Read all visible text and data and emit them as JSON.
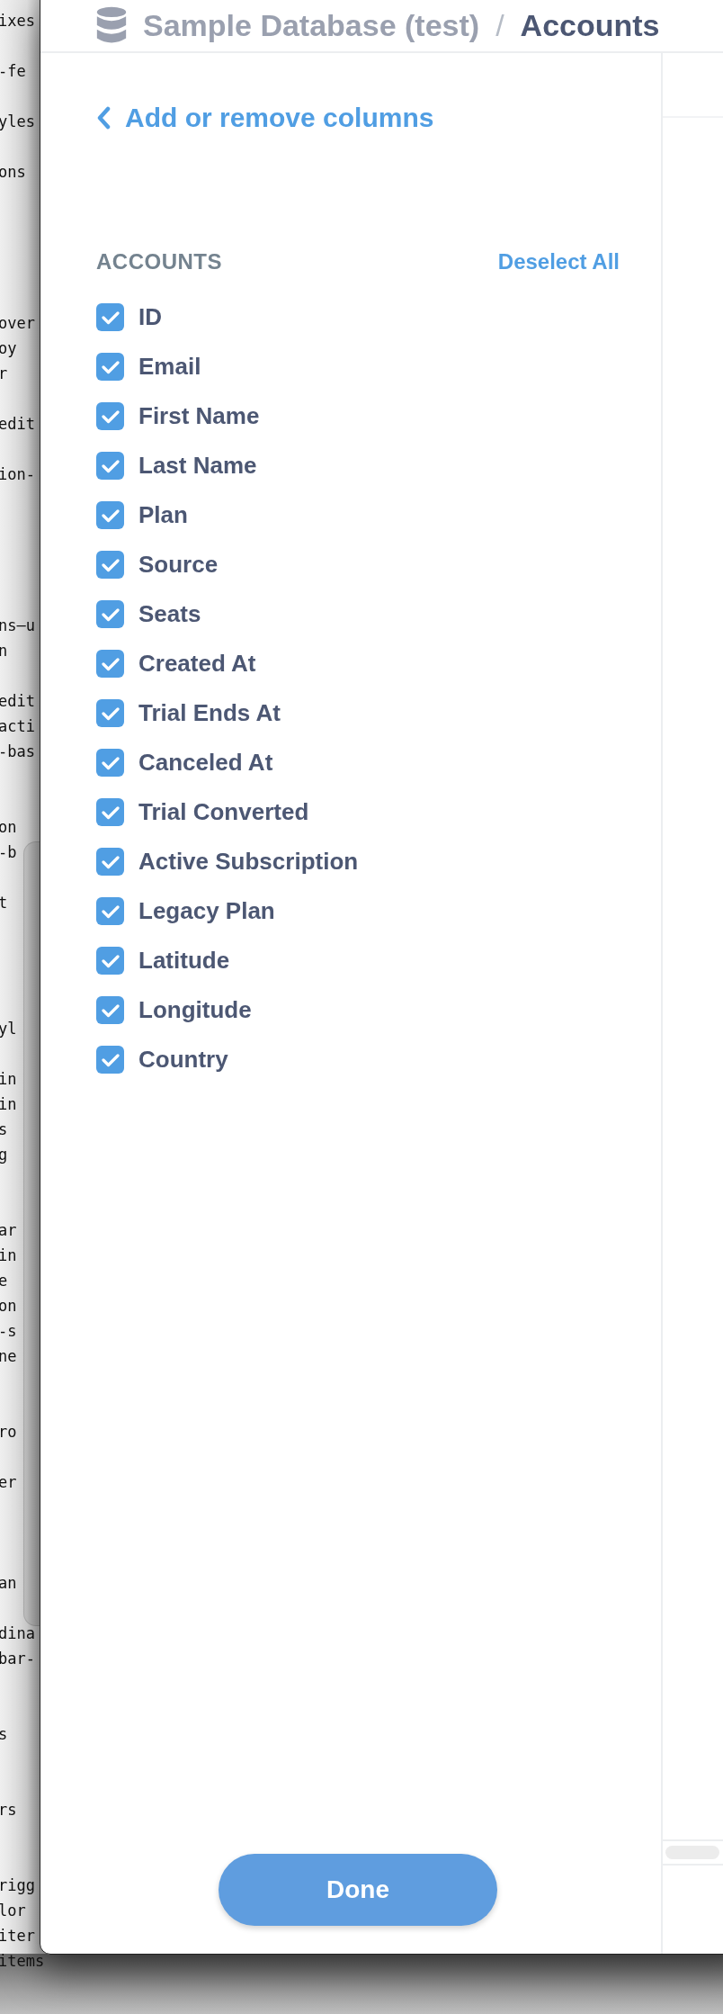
{
  "terminal_lines": [
    "ixes",
    "-fe",
    "yles",
    "ons",
    "over",
    "oy",
    "r",
    "edit",
    "ion-",
    "ns—u",
    "n",
    "edit",
    "acti",
    "-bas",
    "on",
    "-b",
    "t",
    "yl",
    "in",
    "in",
    "s",
    "g",
    "ar",
    "in",
    "e",
    "on",
    "-s",
    "ne",
    "ro",
    "er",
    "an",
    "dina",
    "bar-",
    "s",
    "rs",
    "rigg",
    "lor",
    "iter",
    "items"
  ],
  "header": {
    "database": "Sample Database (test)",
    "separator": "/",
    "table": "Accounts"
  },
  "sidebar": {
    "back_link": "Add or remove columns",
    "section_title": "ACCOUNTS",
    "deselect_all": "Deselect All",
    "columns": [
      {
        "label": "ID",
        "checked": true
      },
      {
        "label": "Email",
        "checked": true
      },
      {
        "label": "First Name",
        "checked": true
      },
      {
        "label": "Last Name",
        "checked": true
      },
      {
        "label": "Plan",
        "checked": true
      },
      {
        "label": "Source",
        "checked": true
      },
      {
        "label": "Seats",
        "checked": true
      },
      {
        "label": "Created At",
        "checked": true
      },
      {
        "label": "Trial Ends At",
        "checked": true
      },
      {
        "label": "Canceled At",
        "checked": true
      },
      {
        "label": "Trial Converted",
        "checked": true
      },
      {
        "label": "Active Subscription",
        "checked": true
      },
      {
        "label": "Legacy Plan",
        "checked": true
      },
      {
        "label": "Latitude",
        "checked": true
      },
      {
        "label": "Longitude",
        "checked": true
      },
      {
        "label": "Country",
        "checked": true
      }
    ],
    "done_button": "Done"
  }
}
